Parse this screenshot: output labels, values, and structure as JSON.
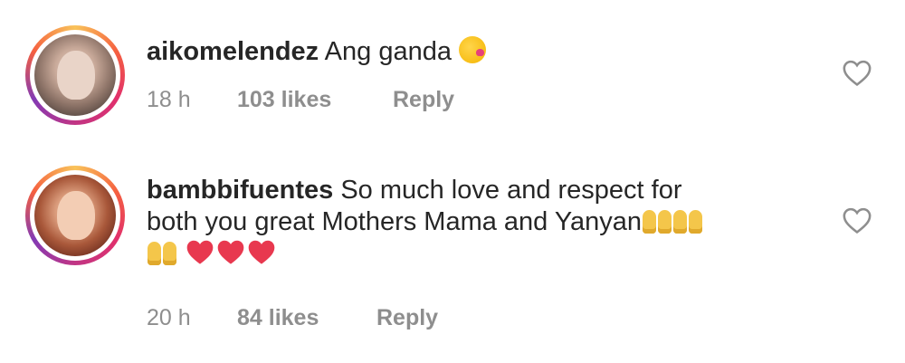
{
  "comments": [
    {
      "username": "aikomelendez",
      "text": "Ang ganda",
      "emojis": [
        "face-blowing-kiss-icon"
      ],
      "time": "18 h",
      "likes": "103 likes",
      "reply_label": "Reply",
      "avatar": "avatar-photo-woman"
    },
    {
      "username": "bambbifuentes",
      "text_line1": "So much love and respect for",
      "text_line2": "both you great Mothers Mama and Yanyan",
      "emojis": [
        "raising-hands-icon",
        "raising-hands-icon",
        "raising-hands-icon",
        "red-heart-icon",
        "red-heart-icon",
        "red-heart-icon"
      ],
      "time": "20 h",
      "likes": "84 likes",
      "reply_label": "Reply",
      "avatar": "avatar-photo-woman"
    }
  ],
  "colors": {
    "text": "#262626",
    "meta": "#8e8e8e",
    "heart_emoji": "#e8384f",
    "hands_emoji": "#f4c64a"
  }
}
